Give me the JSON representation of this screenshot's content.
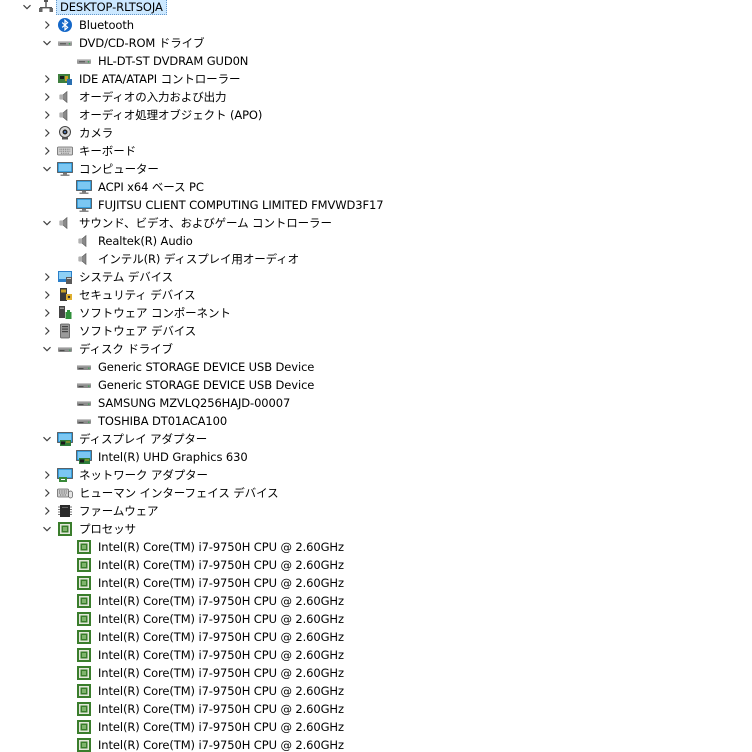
{
  "root": {
    "label": "DESKTOP-RLTSOJA",
    "icon": "computer-icon",
    "expanded": true
  },
  "items": [
    {
      "label": "Bluetooth",
      "icon": "bluetooth-icon",
      "level": 1,
      "state": "collapsed"
    },
    {
      "label": "DVD/CD-ROM ドライブ",
      "icon": "optical-drive-icon",
      "level": 1,
      "state": "expanded"
    },
    {
      "label": "HL-DT-ST DVDRAM GUD0N",
      "icon": "optical-drive-icon",
      "level": 2
    },
    {
      "label": "IDE ATA/ATAPI コントローラー",
      "icon": "ide-controller-icon",
      "level": 1,
      "state": "collapsed"
    },
    {
      "label": "オーディオの入力および出力",
      "icon": "speaker-icon",
      "level": 1,
      "state": "collapsed"
    },
    {
      "label": "オーディオ処理オブジェクト (APO)",
      "icon": "speaker-icon",
      "level": 1,
      "state": "collapsed"
    },
    {
      "label": "カメラ",
      "icon": "camera-icon",
      "level": 1,
      "state": "collapsed"
    },
    {
      "label": "キーボード",
      "icon": "keyboard-icon",
      "level": 1,
      "state": "collapsed"
    },
    {
      "label": "コンピューター",
      "icon": "monitor-icon",
      "level": 1,
      "state": "expanded"
    },
    {
      "label": "ACPI x64 ベース PC",
      "icon": "monitor-icon",
      "level": 2
    },
    {
      "label": "FUJITSU CLIENT COMPUTING LIMITED FMVWD3F17",
      "icon": "monitor-icon",
      "level": 2
    },
    {
      "label": "サウンド、ビデオ、およびゲーム コントローラー",
      "icon": "speaker-icon",
      "level": 1,
      "state": "expanded"
    },
    {
      "label": "Realtek(R) Audio",
      "icon": "speaker-icon",
      "level": 2
    },
    {
      "label": "インテル(R) ディスプレイ用オーディオ",
      "icon": "speaker-icon",
      "level": 2
    },
    {
      "label": "システム デバイス",
      "icon": "system-device-icon",
      "level": 1,
      "state": "collapsed"
    },
    {
      "label": "セキュリティ デバイス",
      "icon": "security-device-icon",
      "level": 1,
      "state": "collapsed"
    },
    {
      "label": "ソフトウェア コンポーネント",
      "icon": "software-component-icon",
      "level": 1,
      "state": "collapsed"
    },
    {
      "label": "ソフトウェア デバイス",
      "icon": "software-device-icon",
      "level": 1,
      "state": "collapsed"
    },
    {
      "label": "ディスク ドライブ",
      "icon": "disk-drive-icon",
      "level": 1,
      "state": "expanded"
    },
    {
      "label": "Generic STORAGE DEVICE USB Device",
      "icon": "disk-drive-icon",
      "level": 2
    },
    {
      "label": "Generic STORAGE DEVICE USB Device",
      "icon": "disk-drive-icon",
      "level": 2
    },
    {
      "label": "SAMSUNG MZVLQ256HAJD-00007",
      "icon": "disk-drive-icon",
      "level": 2
    },
    {
      "label": "TOSHIBA DT01ACA100",
      "icon": "disk-drive-icon",
      "level": 2
    },
    {
      "label": "ディスプレイ アダプター",
      "icon": "display-adapter-icon",
      "level": 1,
      "state": "expanded"
    },
    {
      "label": "Intel(R) UHD Graphics 630",
      "icon": "display-adapter-icon",
      "level": 2
    },
    {
      "label": "ネットワーク アダプター",
      "icon": "network-adapter-icon",
      "level": 1,
      "state": "collapsed"
    },
    {
      "label": "ヒューマン インターフェイス デバイス",
      "icon": "hid-icon",
      "level": 1,
      "state": "collapsed"
    },
    {
      "label": "ファームウェア",
      "icon": "firmware-icon",
      "level": 1,
      "state": "collapsed"
    },
    {
      "label": "プロセッサ",
      "icon": "processor-icon",
      "level": 1,
      "state": "expanded"
    },
    {
      "label": "Intel(R) Core(TM) i7-9750H CPU @ 2.60GHz",
      "icon": "processor-icon",
      "level": 2
    },
    {
      "label": "Intel(R) Core(TM) i7-9750H CPU @ 2.60GHz",
      "icon": "processor-icon",
      "level": 2
    },
    {
      "label": "Intel(R) Core(TM) i7-9750H CPU @ 2.60GHz",
      "icon": "processor-icon",
      "level": 2
    },
    {
      "label": "Intel(R) Core(TM) i7-9750H CPU @ 2.60GHz",
      "icon": "processor-icon",
      "level": 2
    },
    {
      "label": "Intel(R) Core(TM) i7-9750H CPU @ 2.60GHz",
      "icon": "processor-icon",
      "level": 2
    },
    {
      "label": "Intel(R) Core(TM) i7-9750H CPU @ 2.60GHz",
      "icon": "processor-icon",
      "level": 2
    },
    {
      "label": "Intel(R) Core(TM) i7-9750H CPU @ 2.60GHz",
      "icon": "processor-icon",
      "level": 2
    },
    {
      "label": "Intel(R) Core(TM) i7-9750H CPU @ 2.60GHz",
      "icon": "processor-icon",
      "level": 2
    },
    {
      "label": "Intel(R) Core(TM) i7-9750H CPU @ 2.60GHz",
      "icon": "processor-icon",
      "level": 2
    },
    {
      "label": "Intel(R) Core(TM) i7-9750H CPU @ 2.60GHz",
      "icon": "processor-icon",
      "level": 2
    },
    {
      "label": "Intel(R) Core(TM) i7-9750H CPU @ 2.60GHz",
      "icon": "processor-icon",
      "level": 2
    },
    {
      "label": "Intel(R) Core(TM) i7-9750H CPU @ 2.60GHz",
      "icon": "processor-icon",
      "level": 2
    }
  ],
  "colors": {
    "selection_bg": "#cce8ff",
    "chevron": "#404040",
    "monitor_blue": "#1e90d6",
    "processor_green": "#3a7d2c",
    "bluetooth_blue": "#1467c8"
  }
}
